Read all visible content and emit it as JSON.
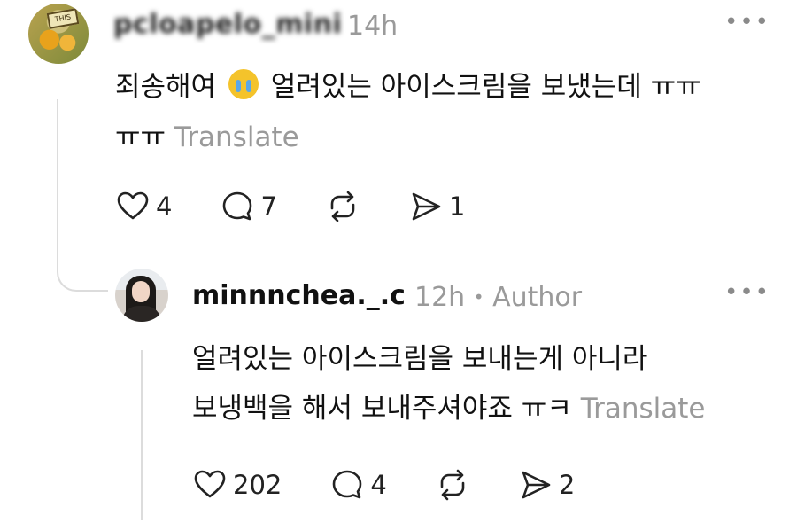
{
  "comment": {
    "username": "pcloapelo_mini",
    "time": "14h",
    "more_label": "•••",
    "line1_before_emoji": "죄송해여",
    "emoji": "crying-face-emoji",
    "line1_after_emoji": "얼려있는 아이스크림을 보냈는데 ㅠㅠ",
    "line2": "ㅠㅠ",
    "translate": "Translate",
    "likes": "4",
    "comments": "7",
    "shares": "1"
  },
  "reply": {
    "username": "minnnchea._.c",
    "time": "12h",
    "separator": "•",
    "role": "Author",
    "more_label": "•••",
    "line1": "얼려있는 아이스크림을 보내는게 아니라",
    "line2": "보냉백을 해서 보내주셔야죠 ㅠㅋ",
    "translate": "Translate",
    "likes": "202",
    "comments": "4",
    "shares": "2"
  },
  "colors": {
    "text": "#111111",
    "muted": "#9a9a9a",
    "thread_line": "#dcdcdc"
  },
  "icons": [
    "heart-icon",
    "comment-icon",
    "repost-icon",
    "send-icon",
    "more-icon"
  ]
}
